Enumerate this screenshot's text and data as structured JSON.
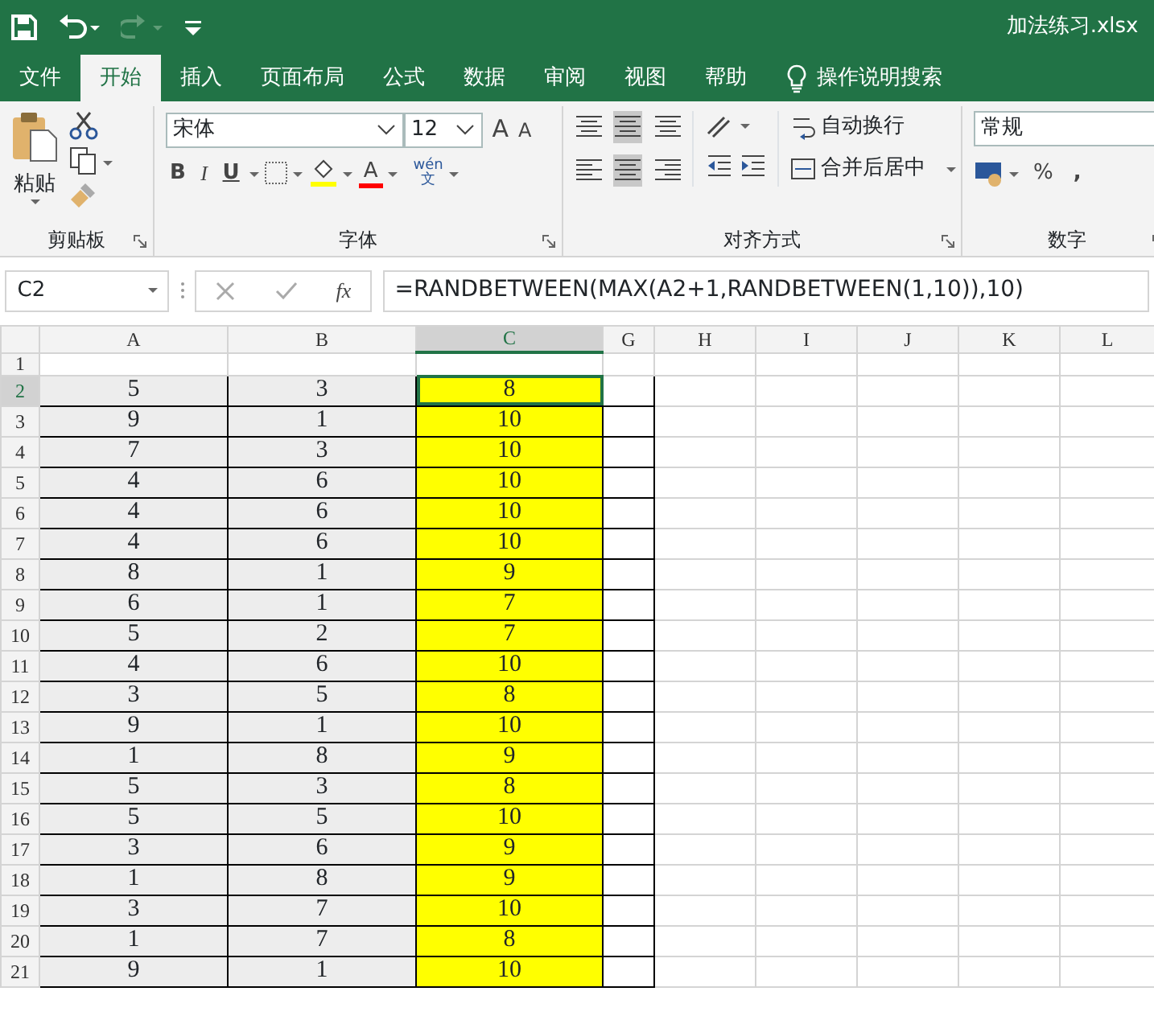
{
  "window": {
    "title": "加法练习.xlsx"
  },
  "tabs": [
    {
      "label": "文件",
      "selected": false
    },
    {
      "label": "开始",
      "selected": true
    },
    {
      "label": "插入",
      "selected": false
    },
    {
      "label": "页面布局",
      "selected": false
    },
    {
      "label": "公式",
      "selected": false
    },
    {
      "label": "数据",
      "selected": false
    },
    {
      "label": "审阅",
      "selected": false
    },
    {
      "label": "视图",
      "selected": false
    },
    {
      "label": "帮助",
      "selected": false
    }
  ],
  "tell_me": {
    "placeholder": "操作说明搜索"
  },
  "ribbon": {
    "clipboard": {
      "paste": "粘贴",
      "label": "剪贴板"
    },
    "font": {
      "name": "宋体",
      "size": "12",
      "grow": "A",
      "shrink": "A",
      "bold": "B",
      "italic": "I",
      "underline": "U",
      "font_color": "A",
      "phonetic_top": "wén",
      "phonetic_bottom": "文",
      "label": "字体"
    },
    "alignment": {
      "wrap_text": "自动换行",
      "merge_center": "合并后居中",
      "label": "对齐方式"
    },
    "number": {
      "format": "常规",
      "percent": "%",
      "comma": ",",
      "label": "数字"
    }
  },
  "formula_bar": {
    "name_box": "C2",
    "fx": "fx",
    "formula": "=RANDBETWEEN(MAX(A2+1,RANDBETWEEN(1,10)),10)"
  },
  "columns": [
    {
      "label": "A",
      "selected": false,
      "color": "#ededed"
    },
    {
      "label": "B",
      "selected": false,
      "color": "#ededed"
    },
    {
      "label": "C",
      "selected": true,
      "color": "#ffff00"
    },
    {
      "label": "G",
      "selected": false
    },
    {
      "label": "H",
      "selected": false
    },
    {
      "label": "I",
      "selected": false
    },
    {
      "label": "J",
      "selected": false
    },
    {
      "label": "K",
      "selected": false
    },
    {
      "label": "L",
      "selected": false
    }
  ],
  "rows": [
    {
      "header": "1",
      "selected": false,
      "cells": []
    },
    {
      "header": "2",
      "selected": true,
      "cells": [
        "5",
        "3",
        "8"
      ]
    },
    {
      "header": "3",
      "selected": false,
      "cells": [
        "9",
        "1",
        "10"
      ]
    },
    {
      "header": "4",
      "selected": false,
      "cells": [
        "7",
        "3",
        "10"
      ]
    },
    {
      "header": "5",
      "selected": false,
      "cells": [
        "4",
        "6",
        "10"
      ]
    },
    {
      "header": "6",
      "selected": false,
      "cells": [
        "4",
        "6",
        "10"
      ]
    },
    {
      "header": "7",
      "selected": false,
      "cells": [
        "4",
        "6",
        "10"
      ]
    },
    {
      "header": "8",
      "selected": false,
      "cells": [
        "8",
        "1",
        "9"
      ]
    },
    {
      "header": "9",
      "selected": false,
      "cells": [
        "6",
        "1",
        "7"
      ]
    },
    {
      "header": "10",
      "selected": false,
      "cells": [
        "5",
        "2",
        "7"
      ]
    },
    {
      "header": "11",
      "selected": false,
      "cells": [
        "4",
        "6",
        "10"
      ]
    },
    {
      "header": "12",
      "selected": false,
      "cells": [
        "3",
        "5",
        "8"
      ]
    },
    {
      "header": "13",
      "selected": false,
      "cells": [
        "9",
        "1",
        "10"
      ]
    },
    {
      "header": "14",
      "selected": false,
      "cells": [
        "1",
        "8",
        "9"
      ]
    },
    {
      "header": "15",
      "selected": false,
      "cells": [
        "5",
        "3",
        "8"
      ]
    },
    {
      "header": "16",
      "selected": false,
      "cells": [
        "5",
        "5",
        "10"
      ]
    },
    {
      "header": "17",
      "selected": false,
      "cells": [
        "3",
        "6",
        "9"
      ]
    },
    {
      "header": "18",
      "selected": false,
      "cells": [
        "1",
        "8",
        "9"
      ]
    },
    {
      "header": "19",
      "selected": false,
      "cells": [
        "3",
        "7",
        "10"
      ]
    },
    {
      "header": "20",
      "selected": false,
      "cells": [
        "1",
        "7",
        "8"
      ]
    },
    {
      "header": "21",
      "selected": false,
      "cells": [
        "9",
        "1",
        "10"
      ]
    }
  ]
}
